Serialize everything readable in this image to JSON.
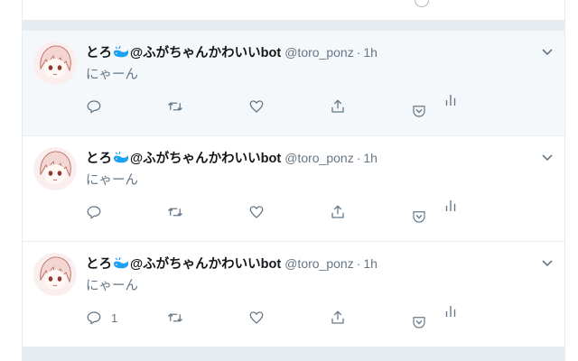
{
  "colors": {
    "icon_gray": "#657786",
    "border": "#e6ecf0",
    "highlight_bg": "#f5f8fa",
    "whale_blue": "#1da1f2"
  },
  "tweets": [
    {
      "display_name": "とろ",
      "name_suffix": "@ふがちゃんかわいいbot",
      "handle": "@toro_ponz",
      "dot": "·",
      "time": "1h",
      "text": "にゃーん",
      "reply_count": "",
      "highlighted": true
    },
    {
      "display_name": "とろ",
      "name_suffix": "@ふがちゃんかわいいbot",
      "handle": "@toro_ponz",
      "dot": "·",
      "time": "1h",
      "text": "にゃーん",
      "reply_count": "",
      "highlighted": false
    },
    {
      "display_name": "とろ",
      "name_suffix": "@ふがちゃんかわいいbot",
      "handle": "@toro_ponz",
      "dot": "·",
      "time": "1h",
      "text": "にゃーん",
      "reply_count": "1",
      "highlighted": false
    }
  ]
}
